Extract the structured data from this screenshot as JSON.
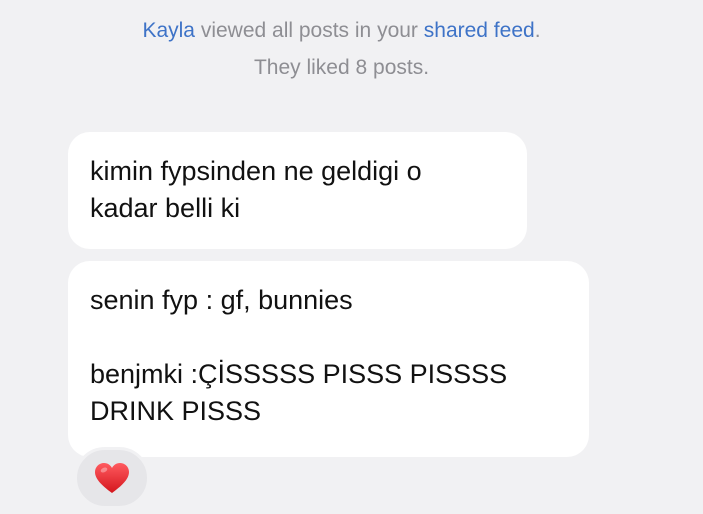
{
  "notice": {
    "user_name": "Kayla",
    "text_part1": " viewed all posts in your ",
    "feed_link": "shared feed",
    "period": ".",
    "line2": "They liked 8 posts."
  },
  "messages": [
    {
      "lines": [
        "kimin fypsinden ne geldigi o",
        "kadar belli ki"
      ]
    },
    {
      "lines": [
        "senin fyp : gf, bunnies",
        "",
        "benjmki :ÇİSSSSS PISSS PISSSS",
        "DRINK PISSS"
      ],
      "reaction": "heart-icon",
      "reaction_color": "#e8242b"
    }
  ],
  "colors": {
    "background": "#f1f1f3",
    "bubble": "#ffffff",
    "link": "#3e73c7",
    "muted_text": "#8e8e93"
  }
}
